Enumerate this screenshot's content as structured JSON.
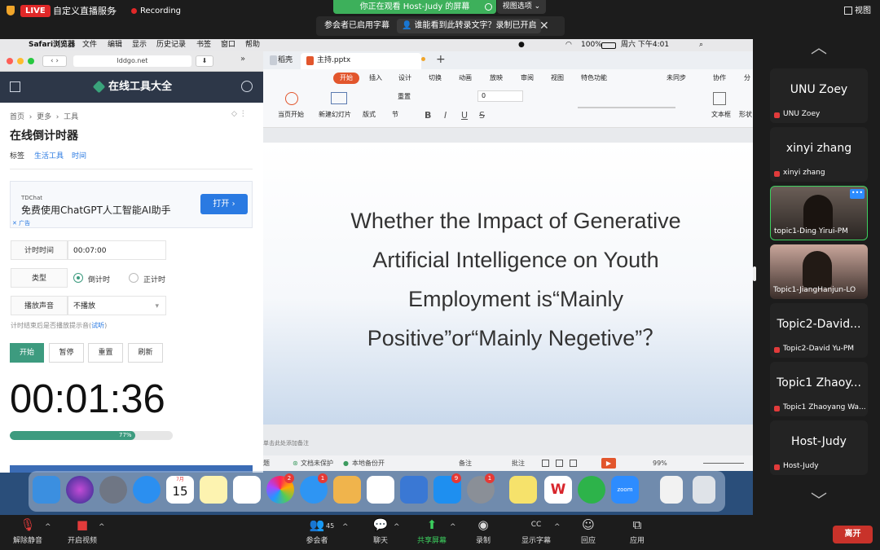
{
  "top_bar": {
    "live_badge": "LIVE",
    "live_service": "自定义直播服务",
    "recording": "Recording",
    "share_banner": "你正在观看 Host-Judy 的屏幕",
    "view_options": "视图选项",
    "caption_enabled": "参会者已启用字幕",
    "caption_who": "谁能看到此转录文字？录制已开启",
    "view_label": "视图"
  },
  "mac_menubar": {
    "app": "Safari浏览器",
    "items": [
      "文件",
      "编辑",
      "显示",
      "历史记录",
      "书签",
      "窗口",
      "帮助"
    ],
    "battery": "100%",
    "clock": "周六 下午4:01"
  },
  "ppt": {
    "tabs": [
      "稻壳",
      "主持.pptx"
    ],
    "ribbon_tabs": [
      "开始",
      "插入",
      "设计",
      "切换",
      "动画",
      "放映",
      "审阅",
      "视图",
      "特色功能"
    ],
    "ribbon_right": [
      "未同步",
      "协作",
      "分"
    ],
    "tools": [
      "当页开始",
      "新建幻灯片",
      "版式",
      "节",
      "重置",
      "文本框",
      "形状"
    ],
    "font_size": "0",
    "slide_lines": [
      "Whether the Impact of Generative",
      "Artificial Intelligence on Youth",
      "Employment is“Mainly",
      "Positive”or“Mainly Negetive”？"
    ],
    "notes_hint": "单击此处添加备注",
    "status": {
      "unsaved": "文档未保护",
      "backup": "本地备份开",
      "notes": "备注",
      "comment": "批注",
      "zoom": "99%",
      "page": "题"
    }
  },
  "lddgo": {
    "url": "lddgo.net",
    "site_title": "在线工具大全",
    "breadcrumb": [
      "首页",
      "更多",
      "工具"
    ],
    "page_title": "在线倒计时器",
    "tags_label": "标签",
    "tags": [
      "生活工具",
      "时间"
    ],
    "ad": {
      "brand": "TDChat",
      "text": "免费使用ChatGPT人工智能AI助手",
      "button": "打开 ›",
      "ad_mark": "广告"
    },
    "timer_label": "计时时间",
    "timer_value": "00:07:00",
    "type_label": "类型",
    "type_options": [
      "倒计时",
      "正计时"
    ],
    "sound_label": "播放声音",
    "sound_value": "不播放",
    "hint": "计时结束后是否播放提示音(",
    "hint_link": "试听",
    "hint_close": ")",
    "buttons": [
      "开始",
      "暂停",
      "重置",
      "刷新"
    ],
    "countdown": "00:01:36",
    "progress": 0.77,
    "progress_label": "77%"
  },
  "dock": {
    "calendar_month": "7月",
    "calendar_day": "15",
    "badges": {
      "photos": "2",
      "messages": "1",
      "appstore": "9",
      "settings": "1"
    },
    "wps": "W",
    "zoom": "zoom"
  },
  "participants": [
    {
      "big": "UNU Zoey",
      "label": "UNU Zoey"
    },
    {
      "big": "xinyi zhang",
      "label": "xinyi zhang"
    },
    {
      "big": "",
      "label": "topic1-Ding Yirui-PM"
    },
    {
      "big": "",
      "label": "Topic1-JiangHanjun-LO"
    },
    {
      "big": "Topic2-David...",
      "label": "Topic2-David Yu-PM"
    },
    {
      "big": "Topic1 Zhaoy...",
      "label": "Topic1 Zhaoyang Wa..."
    },
    {
      "big": "Host-Judy",
      "label": "Host-Judy"
    }
  ],
  "bottom_bar": {
    "unmute": "解除静音",
    "start_video": "开启视频",
    "participants": "参会者",
    "participant_count": "45",
    "chat": "聊天",
    "share": "共享屏幕",
    "record": "录制",
    "captions": "显示字幕",
    "react": "回应",
    "apps": "应用",
    "leave": "离开",
    "cc": "CC"
  }
}
